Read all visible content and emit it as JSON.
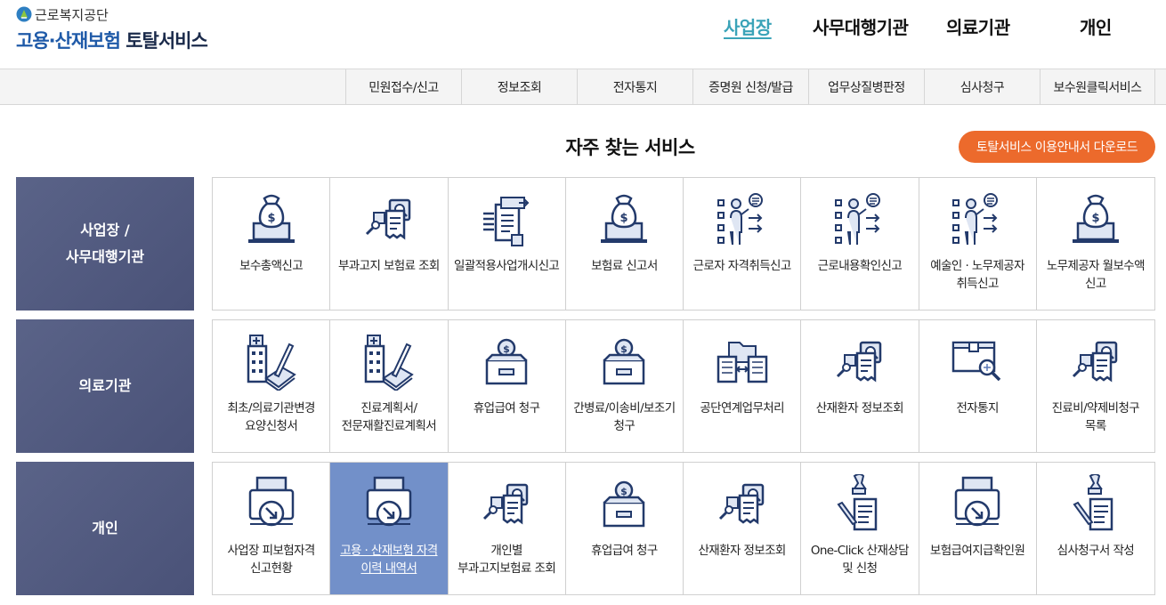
{
  "logo": {
    "org": "근로복지공단",
    "title_blue": "고용·산재보험",
    "title_dark": "토탈서비스"
  },
  "topnav": [
    "사업장",
    "사무대행기관",
    "의료기관",
    "개인"
  ],
  "subnav": [
    "민원접수/신고",
    "정보조회",
    "전자통지",
    "증명원 신청/발급",
    "업무상질병판정",
    "심사청구",
    "보수원클릭서비스"
  ],
  "section_title": "자주 찾는 서비스",
  "download_button": "토탈서비스 이용안내서 다운로드",
  "colors": {
    "accent_orange": "#ec6a2c",
    "category_bg": "#4f5780",
    "active_nav": "#3aa3b8",
    "icon_navy": "#233a6b",
    "highlight": "#7290c9"
  },
  "categories": [
    {
      "label_line1": "사업장 /",
      "label_line2": "사무대행기관",
      "items": [
        {
          "label": "보수총액신고",
          "icon": "money-bag-laptop-icon"
        },
        {
          "label": "부과고지 보험료 조회",
          "icon": "document-search-icon"
        },
        {
          "label": "일괄적용사업개시신고",
          "icon": "document-stack-arrow-icon"
        },
        {
          "label": "보험료 신고서",
          "icon": "money-bag-laptop-icon"
        },
        {
          "label": "근로자 자격취득신고",
          "icon": "person-checklist-icon"
        },
        {
          "label": "근로내용확인신고",
          "icon": "person-checklist-icon"
        },
        {
          "label": "예술인 · 노무제공자 취득신고",
          "icon": "person-checklist-icon"
        },
        {
          "label": "노무제공자 월보수액 신고",
          "icon": "money-bag-laptop-icon"
        }
      ]
    },
    {
      "label_line1": "의료기관",
      "label_line2": "",
      "items": [
        {
          "label": "최초/의료기관변경 요양신청서",
          "icon": "hospital-pen-icon"
        },
        {
          "label": "진료계획서/전문재활진료계획서",
          "icon": "hospital-pen-icon"
        },
        {
          "label": "휴업급여 청구",
          "icon": "coin-box-icon"
        },
        {
          "label": "간병료/이송비/보조기 청구",
          "icon": "coin-box-icon"
        },
        {
          "label": "공단연계업무처리",
          "icon": "folder-exchange-icon"
        },
        {
          "label": "산재환자 정보조회",
          "icon": "document-search-icon"
        },
        {
          "label": "전자통지",
          "icon": "box-magnifier-icon"
        },
        {
          "label": "진료비/약제비청구 목록",
          "icon": "document-search-icon"
        }
      ]
    },
    {
      "label_line1": "개인",
      "label_line2": "",
      "items": [
        {
          "label": "사업장 피보험자격 신고현황",
          "icon": "printer-download-icon"
        },
        {
          "label": "고용 · 산재보험 자격 이력 내역서",
          "icon": "printer-download-icon",
          "highlighted": true
        },
        {
          "label": "개인별 부과고지보험료 조회",
          "icon": "document-search-icon"
        },
        {
          "label": "휴업급여 청구",
          "icon": "coin-box-icon"
        },
        {
          "label": "산재환자 정보조회",
          "icon": "document-search-icon"
        },
        {
          "label": "One-Click 산재상담 및 신청",
          "icon": "stamp-document-icon"
        },
        {
          "label": "보험급여지급확인원",
          "icon": "printer-download-icon"
        },
        {
          "label": "심사청구서 작성",
          "icon": "stamp-document-icon"
        }
      ]
    }
  ]
}
